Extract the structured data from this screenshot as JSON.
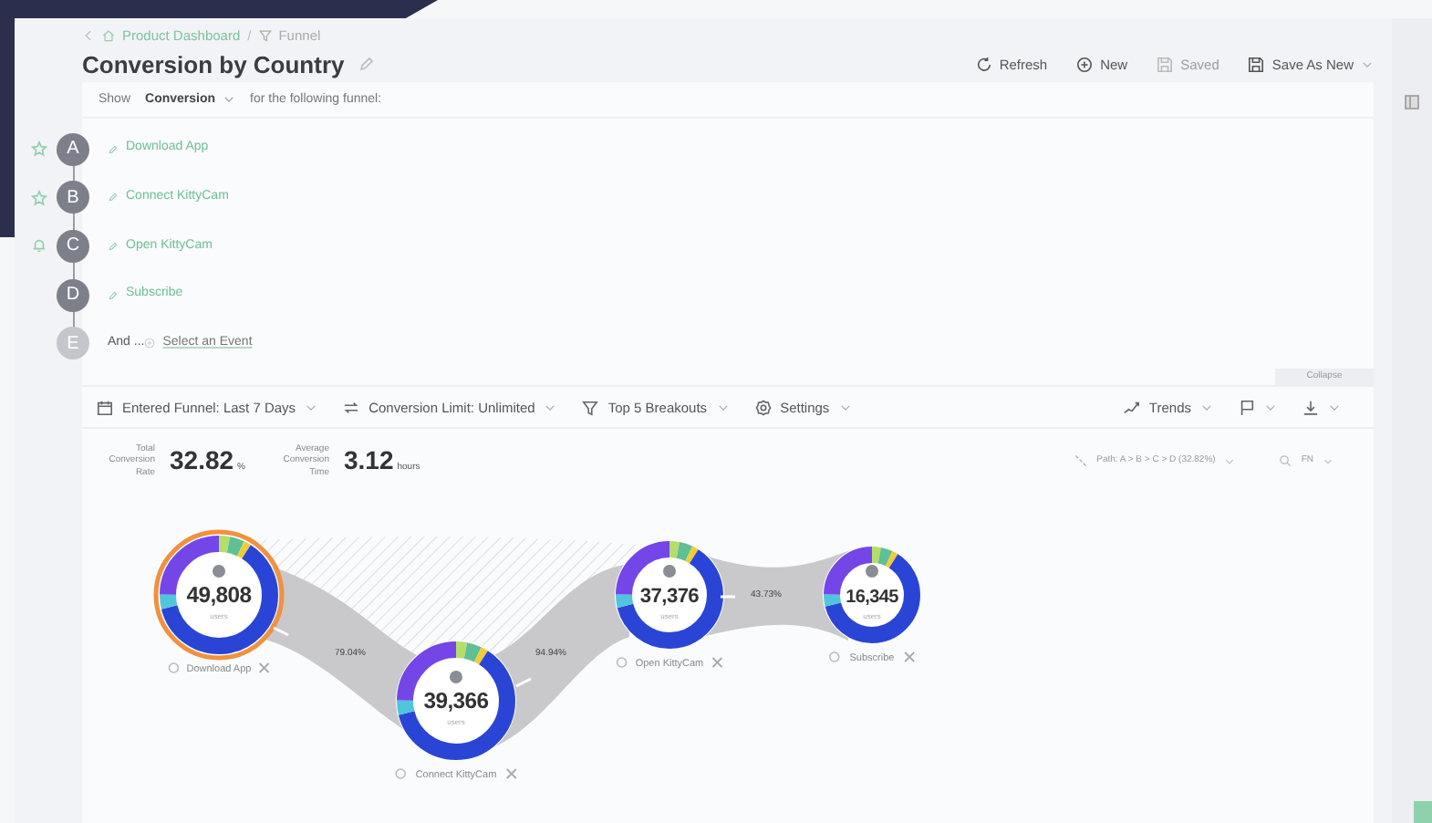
{
  "breadcrumb": [
    {
      "label": "Product Dashboard"
    },
    {
      "label": "Funnel"
    }
  ],
  "title": "Conversion by Country",
  "breadcrumb_separator": "/",
  "actions": [
    {
      "label": "Refresh",
      "disabled": false
    },
    {
      "label": "New",
      "disabled": false
    },
    {
      "label": "Saved",
      "disabled": true
    },
    {
      "label": "Save As New",
      "disabled": false
    }
  ],
  "query": {
    "show_label": "Show",
    "metric": "Conversion",
    "suffix": "for the following funnel:"
  },
  "steps": [
    {
      "kind": "event",
      "letter": "A",
      "event": "Download App"
    },
    {
      "kind": "event",
      "letter": "B",
      "event": "Connect KittyCam"
    },
    {
      "kind": "event",
      "letter": "C",
      "event": "Open KittyCam"
    },
    {
      "kind": "event",
      "letter": "D",
      "event": "Subscribe"
    },
    {
      "kind": "add",
      "letter": "E",
      "prefix": "And ...",
      "placeholder": "Select an Event"
    }
  ],
  "collapse": "Collapse",
  "filters": [
    {
      "label": "Entered Funnel: Last 7 Days"
    },
    {
      "label": "Conversion Limit: Unlimited"
    },
    {
      "label": "Top 5 Breakouts"
    },
    {
      "label": "Settings"
    }
  ],
  "trends": "Trends",
  "stats": [
    {
      "label": "Total Conversion Rate",
      "value": "32.82",
      "unit": "%"
    },
    {
      "label": "Average Conversion Time",
      "value": "3.12",
      "unit": "hours"
    }
  ],
  "path_filter": "Path: A > B > C > D (32.82%)",
  "search_value": "FN",
  "funnel_nodes": [
    {
      "count": "49,808",
      "unit": "users",
      "label": "Download App",
      "selected": true
    },
    {
      "count": "39,366",
      "unit": "users",
      "label": "Connect KittyCam",
      "selected": false
    },
    {
      "count": "37,376",
      "unit": "users",
      "label": "Open KittyCam",
      "selected": false
    },
    {
      "count": "16,345",
      "unit": "users",
      "label": "Subscribe",
      "selected": false
    }
  ],
  "conversions": [
    "79.04%",
    "94.94%",
    "43.73%"
  ]
}
